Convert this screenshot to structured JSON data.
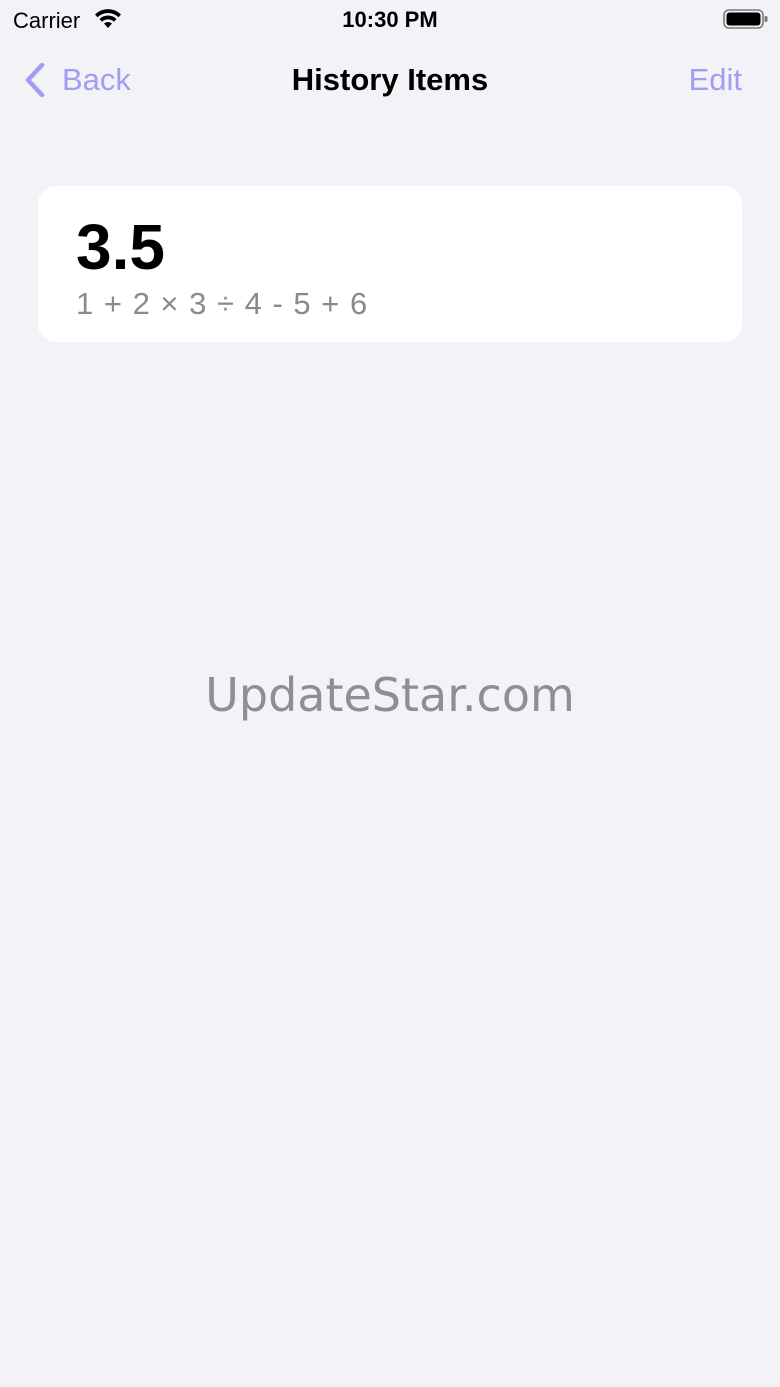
{
  "status_bar": {
    "carrier": "Carrier",
    "time": "10:30 PM",
    "wifi_icon": "wifi-icon",
    "battery_icon": "battery-icon"
  },
  "nav": {
    "back_label": "Back",
    "title": "History Items",
    "edit_label": "Edit",
    "accent_color": "#a09ef2"
  },
  "history": {
    "items": [
      {
        "result": "3.5",
        "expression": "1 + 2 × 3 ÷ 4 - 5 + 6"
      }
    ]
  },
  "watermark": "UpdateStar.com"
}
